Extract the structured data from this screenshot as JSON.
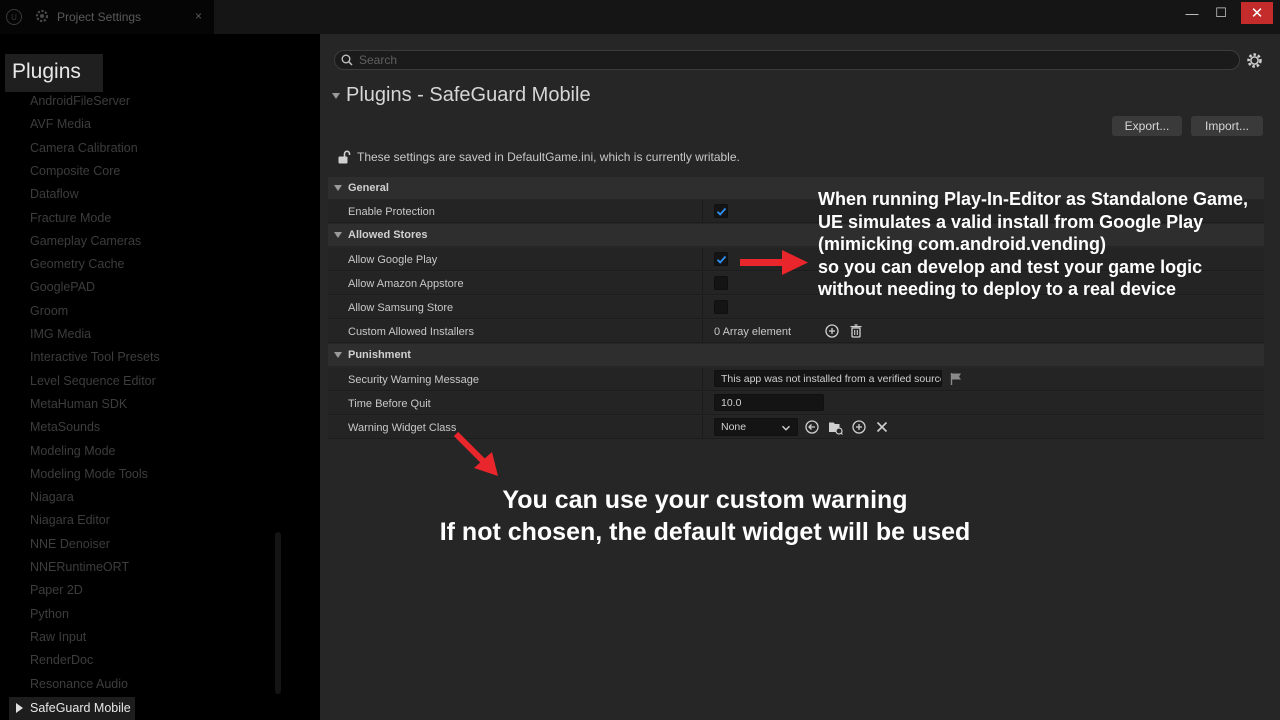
{
  "window": {
    "tab_title": "Project Settings",
    "tab_close": "×",
    "minimize": "—",
    "maximize": "☐",
    "close": "✕"
  },
  "sidebar": {
    "heading": "Plugins",
    "items": [
      "AndroidFileServer",
      "AVF Media",
      "Camera Calibration",
      "Composite Core",
      "Dataflow",
      "Fracture Mode",
      "Gameplay Cameras",
      "Geometry Cache",
      "GooglePAD",
      "Groom",
      "IMG Media",
      "Interactive Tool Presets",
      "Level Sequence Editor",
      "MetaHuman SDK",
      "MetaSounds",
      "Modeling Mode",
      "Modeling Mode Tools",
      "Niagara",
      "Niagara Editor",
      "NNE Denoiser",
      "NNERuntimeORT",
      "Paper 2D",
      "Python",
      "Raw Input",
      "RenderDoc",
      "Resonance Audio"
    ],
    "selected": "SafeGuard Mobile"
  },
  "search": {
    "placeholder": "Search"
  },
  "header": {
    "title": "Plugins - SafeGuard Mobile",
    "export_label": "Export...",
    "import_label": "Import...",
    "info_text": "These settings are saved in DefaultGame.ini, which is currently writable."
  },
  "details": {
    "general": {
      "label": "General",
      "enable_protection": {
        "label": "Enable Protection",
        "checked": true
      }
    },
    "allowed_stores": {
      "label": "Allowed Stores",
      "google_play": {
        "label": "Allow Google Play",
        "checked": true
      },
      "amazon": {
        "label": "Allow Amazon Appstore",
        "checked": false
      },
      "samsung": {
        "label": "Allow Samsung Store",
        "checked": false
      },
      "custom_installers": {
        "label": "Custom Allowed Installers",
        "value": "0 Array element"
      }
    },
    "punishment": {
      "label": "Punishment",
      "warning_message": {
        "label": "Security Warning Message",
        "value": "This app was not installed from a verified source."
      },
      "time_before_quit": {
        "label": "Time Before Quit",
        "value": "10.0"
      },
      "warning_widget_class": {
        "label": "Warning Widget Class",
        "value": "None"
      }
    }
  },
  "annotations": {
    "top_right": [
      "When running Play-In-Editor as Standalone Game,",
      "UE simulates a valid install from Google Play",
      "(mimicking com.android.vending)",
      "so you can develop and test your game logic",
      "without needing to deploy to a real device"
    ],
    "bottom": [
      "You can use your custom warning",
      "If not chosen, the default widget will be used"
    ]
  },
  "colors": {
    "arrow": "#e8262b",
    "checkbox_check": "#2f8ff0",
    "close_button": "#c42b2b"
  }
}
